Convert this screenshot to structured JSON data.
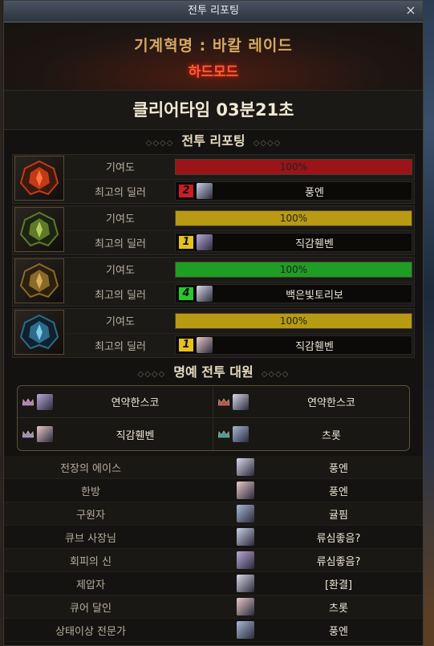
{
  "window": {
    "title": "전투 리포팅",
    "close_label": "×"
  },
  "header": {
    "dungeon": "기계혁명 : 바칼 레이드",
    "mode": "하드모드"
  },
  "clear_time": "클리어타임   03분21초",
  "section_report": "전투 리포팅",
  "section_honor": "명예 전투 대원",
  "ornament": "◇◇◇◇",
  "parties": [
    {
      "contribution_label": "기여도",
      "contribution_value": "100%",
      "contribution_fraction": 1.0,
      "bar_color": "#9b1418",
      "dealer_label": "최고의 딜러",
      "rank": "2",
      "rank_color": "#c81e24",
      "dealer_name": "풍엔",
      "emblem": "red-emblem-icon"
    },
    {
      "contribution_label": "기여도",
      "contribution_value": "100%",
      "contribution_fraction": 1.0,
      "bar_color": "#b89a13",
      "dealer_label": "최고의 딜러",
      "rank": "1",
      "rank_color": "#e6c21a",
      "dealer_name": "직감휀벤",
      "emblem": "green-emblem-icon"
    },
    {
      "contribution_label": "기여도",
      "contribution_value": "100%",
      "contribution_fraction": 1.0,
      "bar_color": "#1e9e23",
      "dealer_label": "최고의 딜러",
      "rank": "4",
      "rank_color": "#28c830",
      "dealer_name": "백은빛토리보",
      "emblem": "gold-emblem-icon"
    },
    {
      "contribution_label": "기여도",
      "contribution_value": "100%",
      "contribution_fraction": 1.0,
      "bar_color": "#b89a13",
      "dealer_label": "최고의 딜러",
      "rank": "1",
      "rank_color": "#e6c21a",
      "dealer_name": "직감휀벤",
      "emblem": "blue-emblem-icon"
    }
  ],
  "honor": [
    "연약한스코",
    "연약한스코",
    "직감휀벤",
    "츠롯"
  ],
  "awards": [
    {
      "label": "전장의 에이스",
      "name": "풍엔"
    },
    {
      "label": "한방",
      "name": "풍엔"
    },
    {
      "label": "구원자",
      "name": "귤핌"
    },
    {
      "label": "큐브 사장님",
      "name": "류심좋음?"
    },
    {
      "label": "회피의 신",
      "name": "류심좋음?"
    },
    {
      "label": "제압자",
      "name": "[환결]"
    },
    {
      "label": "큐어 달인",
      "name": "츠롯"
    },
    {
      "label": "상태이상 전문가",
      "name": "풍엔"
    }
  ]
}
